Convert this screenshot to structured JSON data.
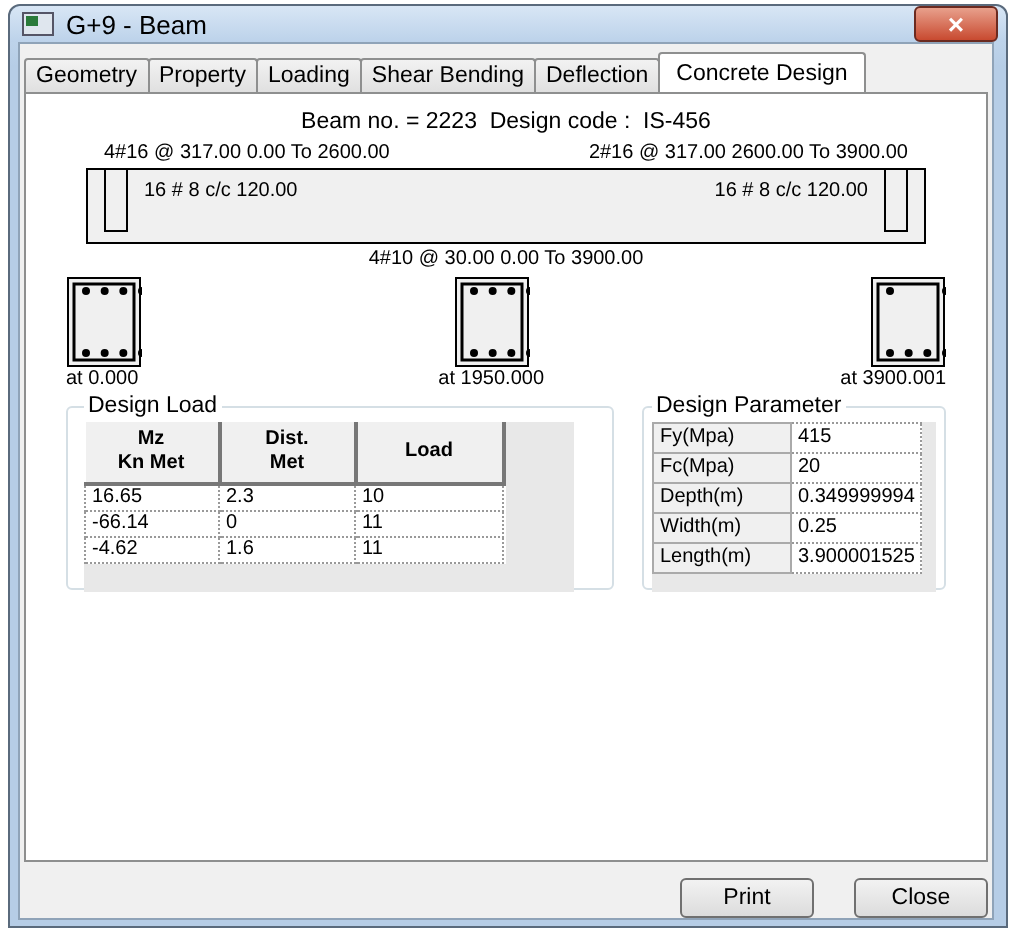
{
  "window": {
    "title": "G+9 - Beam",
    "close": "×"
  },
  "tabs": [
    {
      "label": "Geometry",
      "selected": false
    },
    {
      "label": "Property",
      "selected": false
    },
    {
      "label": "Loading",
      "selected": false
    },
    {
      "label": "Shear Bending",
      "selected": false
    },
    {
      "label": "Deflection",
      "selected": false
    },
    {
      "label": "Concrete Design",
      "selected": true
    }
  ],
  "heading": "Beam no. = 2223  Design code :  IS-456",
  "top_bars": [
    "4#16 @ 317.00 0.00 To 2600.00",
    "2#16 @ 317.00 2600.00 To 3900.00"
  ],
  "stirrups": [
    "16 # 8 c/c 120.00",
    "16 # 8 c/c 120.00"
  ],
  "bottom_bars": "4#10 @ 30.00 0.00 To 3900.00",
  "sections": [
    {
      "label": "at 0.000",
      "kind": "full"
    },
    {
      "label": "at 1950.000",
      "kind": "full"
    },
    {
      "label": "at 3900.001",
      "kind": "corner"
    }
  ],
  "design_load": {
    "title": "Design Load",
    "columns": [
      "Mz\nKn Met",
      "Dist.\nMet",
      "Load"
    ],
    "rows": [
      [
        "16.65",
        "2.3",
        "10"
      ],
      [
        "-66.14",
        "0",
        "11"
      ],
      [
        "-4.62",
        "1.6",
        "11"
      ]
    ]
  },
  "design_parameter": {
    "title": "Design Parameter",
    "rows": [
      [
        "Fy(Mpa)",
        "415"
      ],
      [
        "Fc(Mpa)",
        "20"
      ],
      [
        "Depth(m)",
        "0.349999994"
      ],
      [
        "Width(m)",
        "0.25"
      ],
      [
        "Length(m)",
        "3.900001525"
      ]
    ]
  },
  "buttons": [
    "Print",
    "Close"
  ]
}
